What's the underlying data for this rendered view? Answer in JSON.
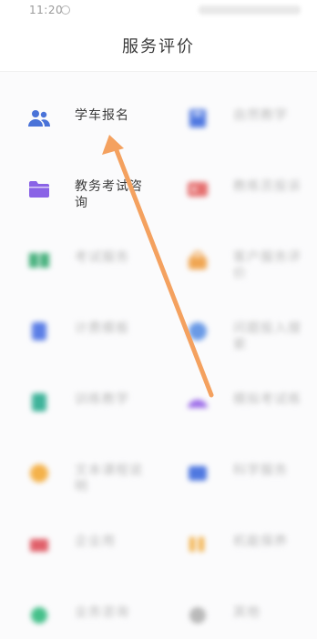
{
  "status": {
    "time": "11:20"
  },
  "header": {
    "title": "服务评价"
  },
  "grid": {
    "items": [
      {
        "label": "学车报名",
        "icon": "people-icon",
        "color": "#4a73d8",
        "sharp": true
      },
      {
        "label": "自然教学",
        "icon": "book-icon",
        "color": "#4f78e0",
        "sharp": false
      },
      {
        "label": "教务考试咨询",
        "icon": "folder-icon",
        "color": "#8a63e6",
        "sharp": true
      },
      {
        "label": "教练员投诉",
        "icon": "badge-icon",
        "color": "#e57070",
        "sharp": false
      },
      {
        "label": "考试服务",
        "icon": "book-open-icon",
        "color": "#46b07c",
        "sharp": false
      },
      {
        "label": "客户服务评价",
        "icon": "bag-icon",
        "color": "#f0a653",
        "sharp": false
      },
      {
        "label": "计费模板",
        "icon": "document-icon",
        "color": "#5b7ee6",
        "sharp": false
      },
      {
        "label": "问题投入搜索",
        "icon": "bubble-icon",
        "color": "#6a9ae6",
        "sharp": false
      },
      {
        "label": "训练教学",
        "icon": "file-icon",
        "color": "#3fb39a",
        "sharp": false
      },
      {
        "label": "模拟考试练",
        "icon": "car-icon",
        "color": "#9b6be8",
        "sharp": false
      },
      {
        "label": "文本课程说明",
        "icon": "chat-icon",
        "color": "#f4b24a",
        "sharp": false
      },
      {
        "label": "科学服务",
        "icon": "card-icon",
        "color": "#4f78e0",
        "sharp": false
      },
      {
        "label": "企业用",
        "icon": "gift-icon",
        "color": "#e0606a",
        "sharp": false
      },
      {
        "label": "机能保养",
        "icon": "bars-icon",
        "color": "#f2b14a",
        "sharp": false
      },
      {
        "label": "业务咨询",
        "icon": "leaf-icon",
        "color": "#45c08a",
        "sharp": false
      },
      {
        "label": "其他",
        "icon": "circle-icon",
        "color": "#b9b9b9",
        "sharp": false
      }
    ]
  },
  "annotation": {
    "arrow_color": "#f4a15f"
  }
}
